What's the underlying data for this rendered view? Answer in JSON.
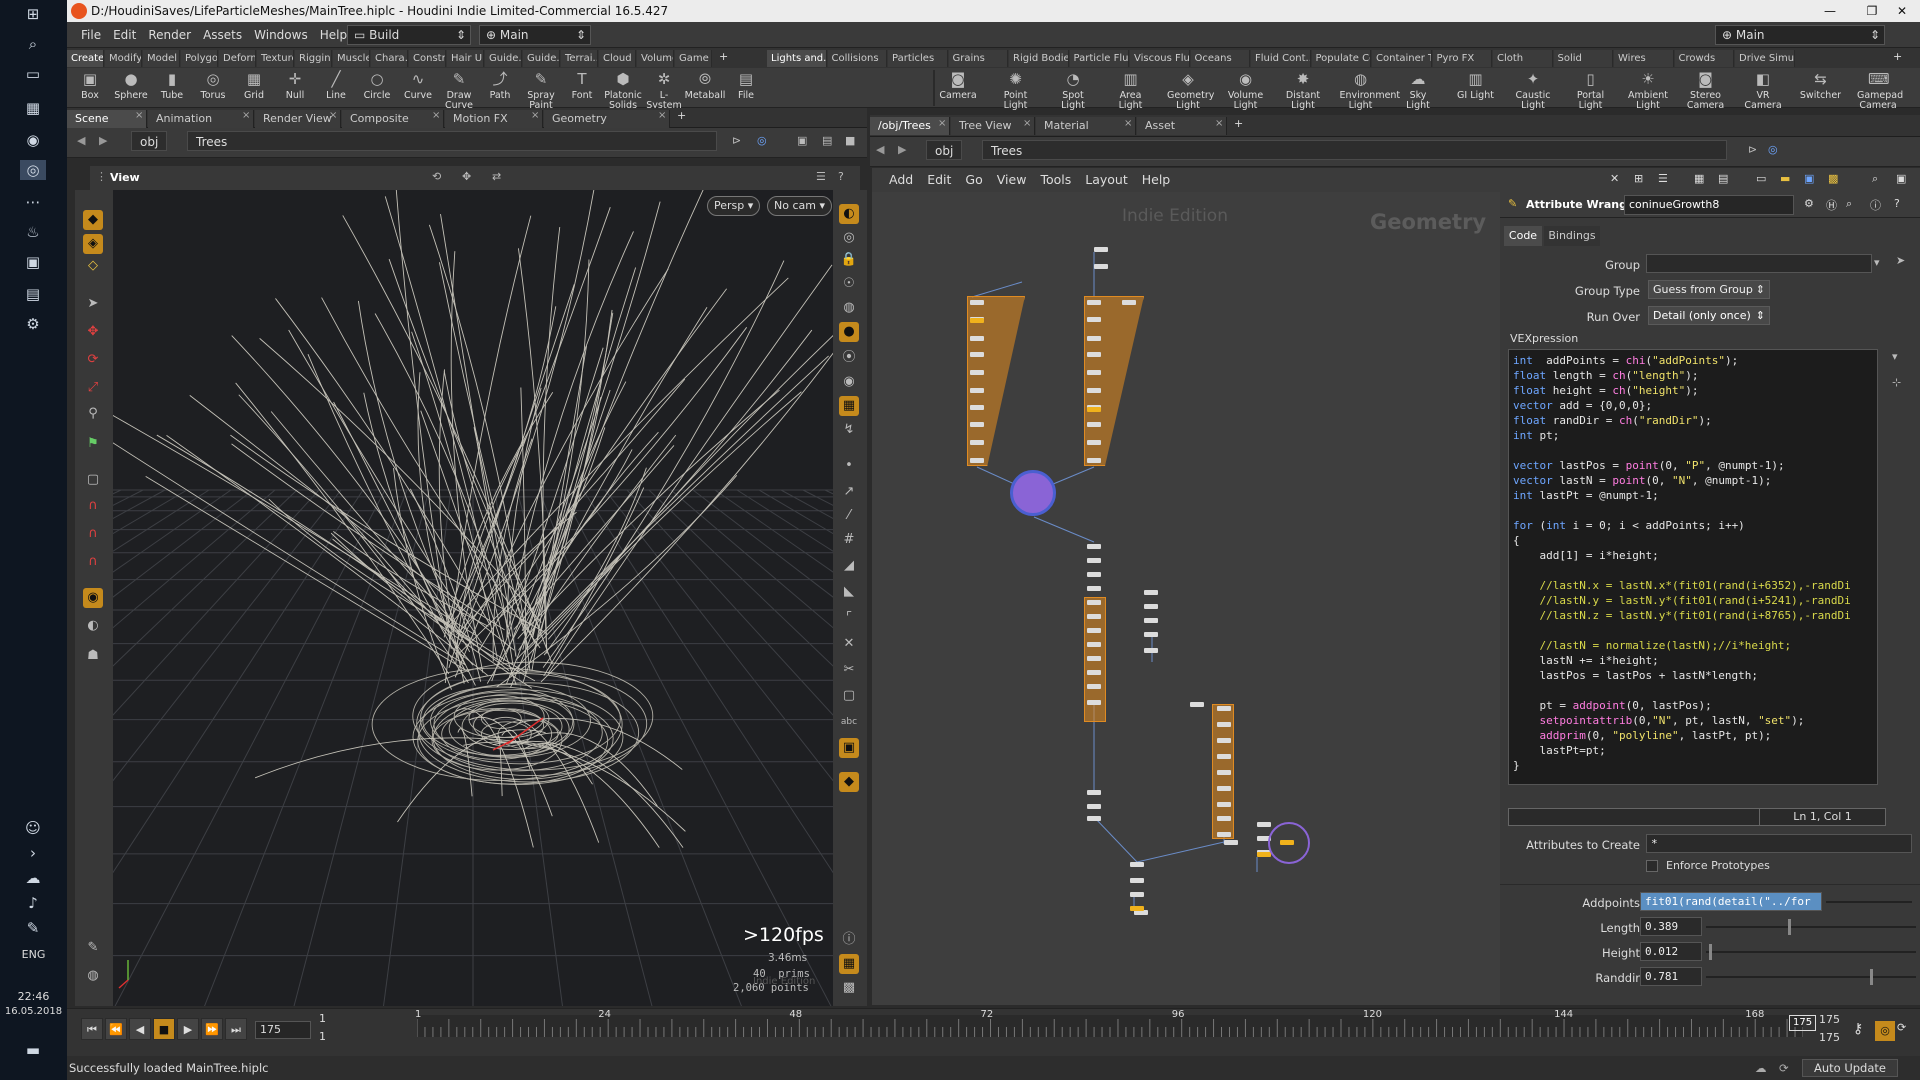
{
  "window": {
    "title": "D:/HoudiniSaves/LifeParticleMeshes/MainTree.hiplc - Houdini Indie Limited-Commercial 16.5.427"
  },
  "menubar": {
    "items": [
      "File",
      "Edit",
      "Render",
      "Assets",
      "Windows",
      "Help"
    ],
    "desktop": "Build",
    "context": "Main",
    "right_context": "Main"
  },
  "shelf_tabs_left": [
    "Create",
    "Modify",
    "Model",
    "Polygon",
    "Deform",
    "Texture",
    "Rigging",
    "Muscles",
    "Chara...",
    "Constr...",
    "Hair U...",
    "Guide...",
    "Guide...",
    "Terrai...",
    "Cloud FX",
    "Volume",
    "Game D..."
  ],
  "shelf_tabs_right": [
    "Lights and...",
    "Collisions",
    "Particles",
    "Grains",
    "Rigid Bodies",
    "Particle Flu...",
    "Viscous Flu...",
    "Oceans",
    "Fluid Cont...",
    "Populate Co...",
    "Container T...",
    "Pyro FX",
    "Cloth",
    "Solid",
    "Wires",
    "Crowds",
    "Drive Simu..."
  ],
  "tools_left": [
    {
      "label": "Box",
      "icon": "box-icon"
    },
    {
      "label": "Sphere",
      "icon": "sphere-icon"
    },
    {
      "label": "Tube",
      "icon": "tube-icon"
    },
    {
      "label": "Torus",
      "icon": "torus-icon"
    },
    {
      "label": "Grid",
      "icon": "grid-icon"
    },
    {
      "label": "Null",
      "icon": "null-icon"
    },
    {
      "label": "Line",
      "icon": "line-icon"
    },
    {
      "label": "Circle",
      "icon": "circle-icon"
    },
    {
      "label": "Curve",
      "icon": "curve-icon"
    },
    {
      "label": "Draw Curve",
      "icon": "draw-curve-icon"
    },
    {
      "label": "Path",
      "icon": "path-icon"
    },
    {
      "label": "Spray Paint",
      "icon": "spray-paint-icon"
    },
    {
      "label": "Font",
      "icon": "font-icon"
    },
    {
      "label": "Platonic Solids",
      "icon": "platonic-icon"
    },
    {
      "label": "L-System",
      "icon": "lsystem-icon"
    },
    {
      "label": "Metaball",
      "icon": "metaball-icon"
    },
    {
      "label": "File",
      "icon": "file-icon"
    }
  ],
  "tools_right": [
    {
      "label": "Camera",
      "icon": "camera-icon"
    },
    {
      "label": "Point Light",
      "icon": "point-light-icon"
    },
    {
      "label": "Spot Light",
      "icon": "spot-light-icon"
    },
    {
      "label": "Area Light",
      "icon": "area-light-icon"
    },
    {
      "label": "Geometry Light",
      "icon": "geometry-light-icon"
    },
    {
      "label": "Volume Light",
      "icon": "volume-light-icon"
    },
    {
      "label": "Distant Light",
      "icon": "distant-light-icon"
    },
    {
      "label": "Environment Light",
      "icon": "environment-light-icon"
    },
    {
      "label": "Sky Light",
      "icon": "sky-light-icon"
    },
    {
      "label": "GI Light",
      "icon": "gi-light-icon"
    },
    {
      "label": "Caustic Light",
      "icon": "caustic-light-icon"
    },
    {
      "label": "Portal Light",
      "icon": "portal-light-icon"
    },
    {
      "label": "Ambient Light",
      "icon": "ambient-light-icon"
    },
    {
      "label": "Stereo Camera",
      "icon": "stereo-camera-icon"
    },
    {
      "label": "VR Camera",
      "icon": "vr-camera-icon"
    },
    {
      "label": "Switcher",
      "icon": "switcher-icon"
    },
    {
      "label": "Gamepad Camera",
      "icon": "gamepad-camera-icon"
    }
  ],
  "left_panel": {
    "tabs": [
      "Scene View",
      "Animation Editor",
      "Render View",
      "Composite View",
      "Motion FX View",
      "Geometry Spreadsheet"
    ],
    "path": [
      "obj",
      "Trees"
    ],
    "view_label": "View",
    "persp": "Persp",
    "cam": "No cam",
    "fps": ">120fps",
    "ms": "3.46ms",
    "prims": "40  prims",
    "points": "2,060 points",
    "watermark": "Indie Edition"
  },
  "right_panel": {
    "tabs": [
      "/obj/Trees",
      "Tree View",
      "Material Palette",
      "Asset Browser"
    ],
    "path": [
      "obj",
      "Trees"
    ],
    "menu": [
      "Add",
      "Edit",
      "Go",
      "View",
      "Tools",
      "Layout",
      "Help"
    ],
    "watermark": "Indie Edition",
    "context_label": "Geometry"
  },
  "params": {
    "node_type": "Attribute Wrangle",
    "node_name": "coninueGrowth8",
    "tabs": [
      "Code",
      "Bindings"
    ],
    "group_label": "Group",
    "group_value": "",
    "group_type_label": "Group Type",
    "group_type_value": "Guess from Group",
    "run_over_label": "Run Over",
    "run_over_value": "Detail (only once)",
    "vex_label": "VEXpression",
    "cursor_pos": "Ln 1, Col 1",
    "attrs_label": "Attributes to Create",
    "attrs_value": "*",
    "enforce_label": "Enforce Prototypes",
    "addpoints_label": "Addpoints",
    "addpoints_value": "fit01(rand(detail(\"../for",
    "length_label": "Length",
    "length_value": "0.389",
    "length_frac": 0.389,
    "height_label": "Height",
    "height_value": "0.012",
    "height_frac": 0.012,
    "randdir_label": "Randdir",
    "randdir_value": "0.781",
    "randdir_frac": 0.781
  },
  "code_lines": [
    [
      [
        "kw",
        "int"
      ],
      [
        "",
        "  addPoints = "
      ],
      [
        "fn",
        "chi"
      ],
      [
        "",
        "("
      ],
      [
        "st",
        "\"addPoints\""
      ],
      [
        "",
        ");"
      ]
    ],
    [
      [
        "kw",
        "float"
      ],
      [
        "",
        " length = "
      ],
      [
        "fn",
        "ch"
      ],
      [
        "",
        "("
      ],
      [
        "st",
        "\"length\""
      ],
      [
        "",
        ");"
      ]
    ],
    [
      [
        "kw",
        "float"
      ],
      [
        "",
        " height = "
      ],
      [
        "fn",
        "ch"
      ],
      [
        "",
        "("
      ],
      [
        "st",
        "\"height\""
      ],
      [
        "",
        ");"
      ]
    ],
    [
      [
        "kw",
        "vector"
      ],
      [
        "",
        " add = {0,0,0};"
      ]
    ],
    [
      [
        "kw",
        "float"
      ],
      [
        "",
        " randDir = "
      ],
      [
        "fn",
        "ch"
      ],
      [
        "",
        "("
      ],
      [
        "st",
        "\"randDir\""
      ],
      [
        "",
        ");"
      ]
    ],
    [
      [
        "kw",
        "int"
      ],
      [
        "",
        " pt;"
      ]
    ],
    [
      [
        "",
        ""
      ]
    ],
    [
      [
        "kw",
        "vector"
      ],
      [
        "",
        " lastPos = "
      ],
      [
        "fn",
        "point"
      ],
      [
        "",
        "(0, "
      ],
      [
        "st",
        "\"P\""
      ],
      [
        "",
        ", @numpt-1);"
      ]
    ],
    [
      [
        "kw",
        "vector"
      ],
      [
        "",
        " lastN = "
      ],
      [
        "fn",
        "point"
      ],
      [
        "",
        "(0, "
      ],
      [
        "st",
        "\"N\""
      ],
      [
        "",
        ", @numpt-1);"
      ]
    ],
    [
      [
        "kw",
        "int"
      ],
      [
        "",
        " lastPt = @numpt-1;"
      ]
    ],
    [
      [
        "",
        ""
      ]
    ],
    [
      [
        "kw",
        "for"
      ],
      [
        "",
        " ("
      ],
      [
        "kw",
        "int"
      ],
      [
        "",
        " i = 0; i < addPoints; i++)"
      ]
    ],
    [
      [
        "",
        "{"
      ]
    ],
    [
      [
        "",
        "    add[1] = i*height;"
      ]
    ],
    [
      [
        "",
        ""
      ]
    ],
    [
      [
        "cm",
        "    //lastN.x = lastN.x*(fit01(rand(i+6352),-randDi"
      ]
    ],
    [
      [
        "cm",
        "    //lastN.y = lastN.y*(fit01(rand(i+5241),-randDi"
      ]
    ],
    [
      [
        "cm",
        "    //lastN.z = lastN.y*(fit01(rand(i+8765),-randDi"
      ]
    ],
    [
      [
        "",
        ""
      ]
    ],
    [
      [
        "cm",
        "    //lastN = normalize(lastN);//i*height;"
      ]
    ],
    [
      [
        "",
        "    lastN += i*height;"
      ]
    ],
    [
      [
        "",
        "    lastPos = lastPos + lastN*length;"
      ]
    ],
    [
      [
        "",
        ""
      ]
    ],
    [
      [
        "",
        "    pt = "
      ],
      [
        "fn",
        "addpoint"
      ],
      [
        "",
        "(0, lastPos);"
      ]
    ],
    [
      [
        "",
        "    "
      ],
      [
        "fn",
        "setpointattrib"
      ],
      [
        "",
        "(0,"
      ],
      [
        "st",
        "\"N\""
      ],
      [
        "",
        ", pt, lastN, "
      ],
      [
        "st",
        "\"set\""
      ],
      [
        "",
        ");"
      ]
    ],
    [
      [
        "",
        "    "
      ],
      [
        "fn",
        "addprim"
      ],
      [
        "",
        "(0, "
      ],
      [
        "st",
        "\"polyline\""
      ],
      [
        "",
        ", lastPt, pt);"
      ]
    ],
    [
      [
        "",
        "    lastPt=pt;"
      ]
    ],
    [
      [
        "",
        "}"
      ]
    ]
  ],
  "timeline": {
    "frame": "175",
    "start": "1",
    "start2": "1",
    "ticks": [
      "1",
      "24",
      "48",
      "72",
      "96",
      "120",
      "144",
      "168"
    ],
    "current_marker": "175",
    "end": "175",
    "end2": "175",
    "auto_update": "Auto Update"
  },
  "status": {
    "message": "Successfully loaded MainTree.hiplc"
  },
  "taskbar": {
    "time": "22:46",
    "date": "16.05.2018",
    "lang": "ENG"
  },
  "colors": {
    "accent": "#c58a1c",
    "node_orange": "#e08b22",
    "selection": "#8a64d6"
  }
}
